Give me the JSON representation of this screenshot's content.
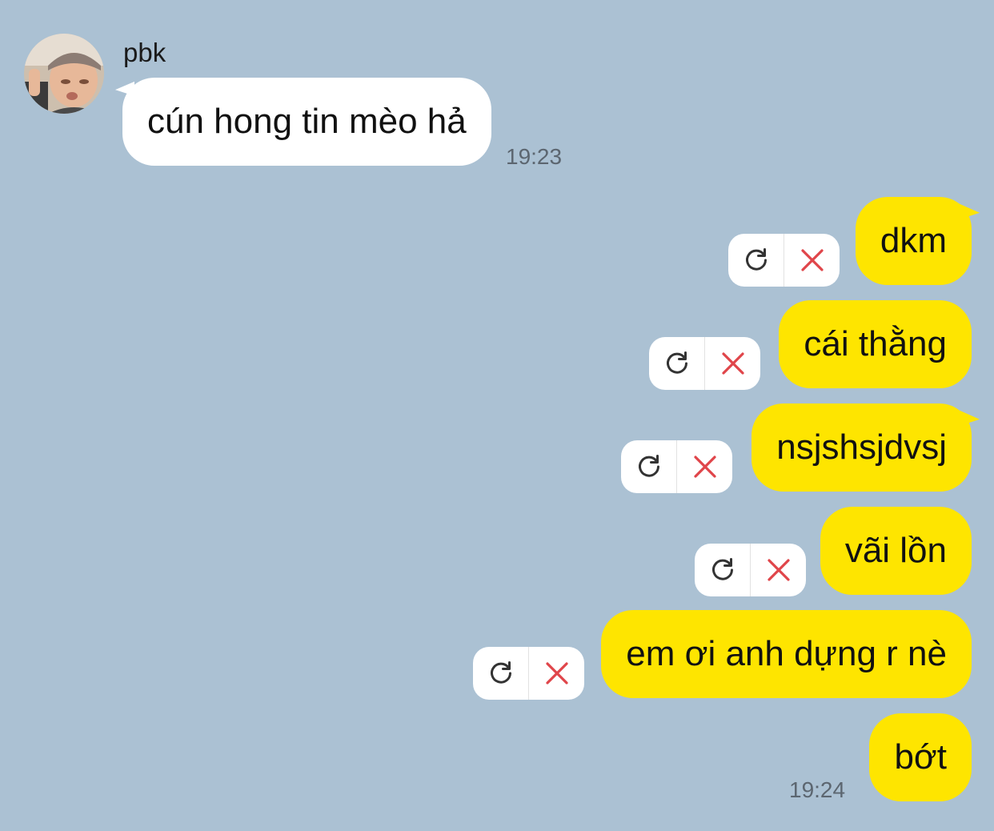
{
  "chat": {
    "incoming": {
      "sender_name": "pbk",
      "text": "cún hong tin mèo hả",
      "time": "19:23"
    },
    "outgoing": [
      {
        "text": "dkm",
        "status": "failed"
      },
      {
        "text": "cái thằng",
        "status": "failed"
      },
      {
        "text": "nsjshsjdvsj",
        "status": "failed"
      },
      {
        "text": "vãi lồn",
        "status": "failed"
      },
      {
        "text": "em ơi anh dựng r nè",
        "status": "failed"
      },
      {
        "text": "bớt",
        "status": "sent"
      }
    ],
    "outgoing_time": "19:24"
  },
  "icons": {
    "retry": "retry-icon",
    "delete": "close-icon"
  },
  "colors": {
    "background": "#abc1d3",
    "incoming_bubble": "#ffffff",
    "outgoing_bubble": "#fee500",
    "delete_icon": "#e0454a",
    "retry_icon": "#333333",
    "timestamp": "#5c6670"
  }
}
